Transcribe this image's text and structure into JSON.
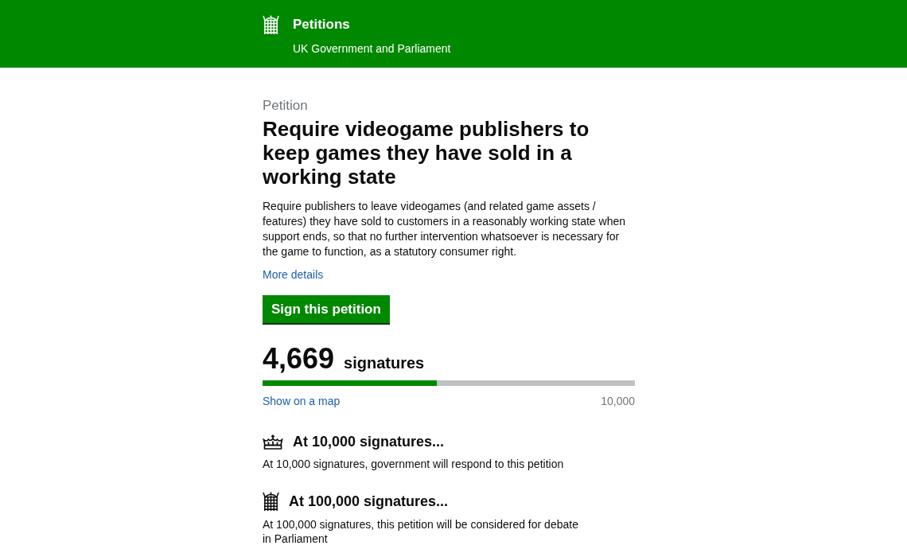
{
  "header": {
    "title": "Petitions",
    "subtitle": "UK Government and Parliament"
  },
  "petition": {
    "label": "Petition",
    "title": "Require videogame publishers to keep games they have sold in a working state",
    "description": "Require publishers to leave videogames (and related game assets / features) they have sold to customers in a reasonably working state when support ends, so that no further intervention whatsoever is necessary for the game to function, as a statutory consumer right.",
    "more_details": "More details",
    "sign_button": "Sign this petition"
  },
  "signatures": {
    "count": "4,669",
    "unit": "signatures",
    "level": 0.4669,
    "map_link": "Show on a map",
    "target": "10,000"
  },
  "milestones": [
    {
      "kind": "government",
      "heading": "At 10,000 signatures...",
      "text": "At 10,000 signatures, government will respond to this petition"
    },
    {
      "kind": "parliament",
      "heading": "At 100,000 signatures...",
      "text": "At 100,000 signatures, this petition will be considered for debate in Parliament"
    }
  ]
}
